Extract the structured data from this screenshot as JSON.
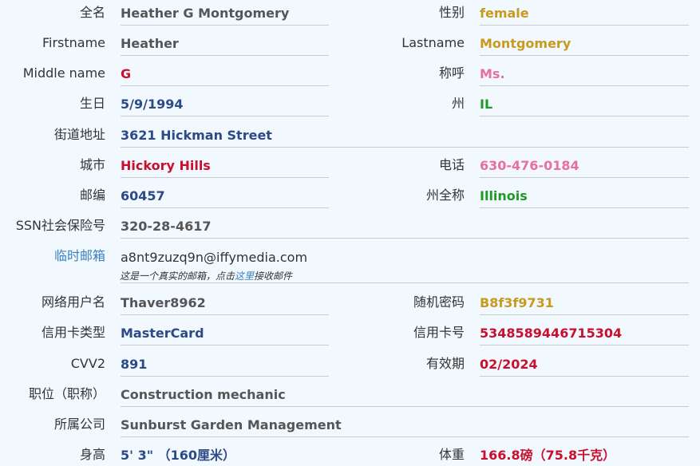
{
  "fields": {
    "fullname": {
      "label": "全名",
      "value": "Heather G Montgomery"
    },
    "gender": {
      "label": "性别",
      "value": "female"
    },
    "firstname": {
      "label": "Firstname",
      "value": "Heather"
    },
    "lastname": {
      "label": "Lastname",
      "value": "Montgomery"
    },
    "middlename": {
      "label": "Middle name",
      "value": "G"
    },
    "title": {
      "label": "称呼",
      "value": "Ms."
    },
    "birthday": {
      "label": "生日",
      "value": "5/9/1994"
    },
    "state": {
      "label": "州",
      "value": "IL"
    },
    "street": {
      "label": "街道地址",
      "value": "3621 Hickman Street"
    },
    "city": {
      "label": "城市",
      "value": "Hickory Hills"
    },
    "phone": {
      "label": "电话",
      "value": "630-476-0184"
    },
    "zipcode": {
      "label": "邮编",
      "value": "60457"
    },
    "state_full": {
      "label": "州全称",
      "value": "Illinois"
    },
    "ssn": {
      "label": "SSN社会保险号",
      "value": "320-28-4617"
    },
    "temp_email": {
      "label": "临时邮箱",
      "value": "a8nt9zuzq9n@iffymedia.com"
    },
    "username": {
      "label": "网络用户名",
      "value": "Thaver8962"
    },
    "password": {
      "label": "随机密码",
      "value": "B8f3f9731"
    },
    "card_type": {
      "label": "信用卡类型",
      "value": "MasterCard"
    },
    "card_number": {
      "label": "信用卡号",
      "value": "5348589446715304"
    },
    "cvv2": {
      "label": "CVV2",
      "value": "891"
    },
    "expiry": {
      "label": "有效期",
      "value": "02/2024"
    },
    "occupation": {
      "label": "职位（职称）",
      "value": "Construction mechanic"
    },
    "company": {
      "label": "所属公司",
      "value": "Sunburst Garden Management"
    },
    "height": {
      "label": "身高",
      "value": "5' 3\"  （160厘米）"
    },
    "weight": {
      "label": "体重",
      "value": "166.8磅（75.8千克）"
    }
  },
  "email_note": {
    "before": "这是一个真实的邮箱，点击",
    "link": "这里",
    "after": "接收邮件"
  }
}
